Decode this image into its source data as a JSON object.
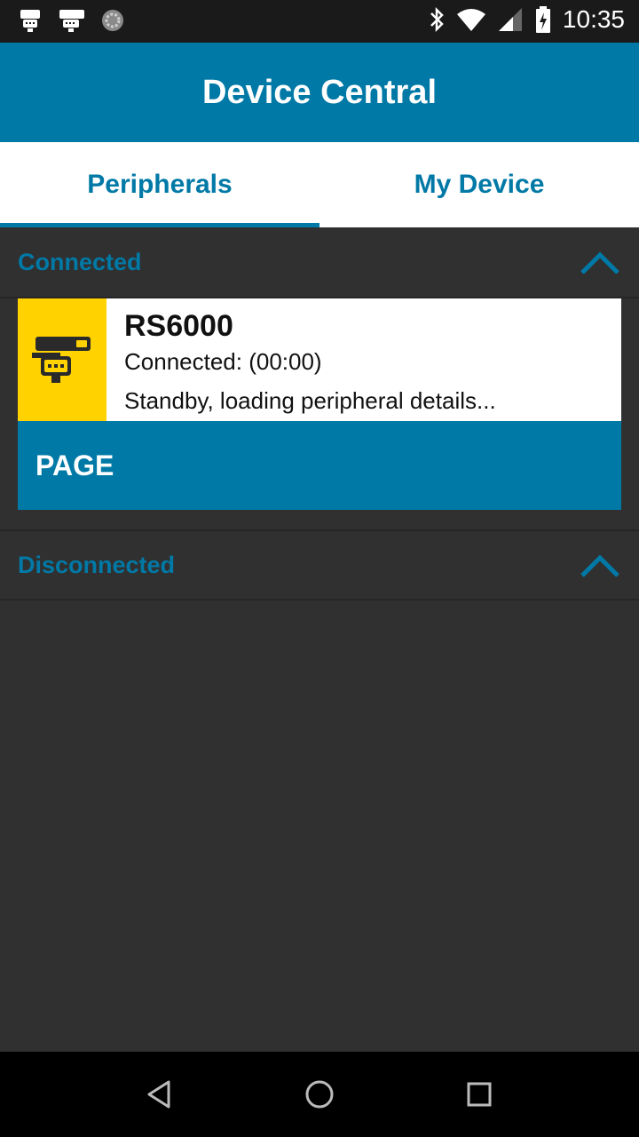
{
  "status_bar": {
    "time": "10:35",
    "left_icons": [
      "scanner-notification-icon",
      "scanner-notification-icon",
      "sync-icon"
    ],
    "right_icons": [
      "bluetooth-icon",
      "wifi-icon",
      "signal-icon",
      "battery-charging-icon"
    ]
  },
  "app_bar": {
    "title": "Device Central"
  },
  "tabs": [
    {
      "label": "Peripherals",
      "active": true
    },
    {
      "label": "My Device",
      "active": false
    }
  ],
  "sections": {
    "connected": {
      "label": "Connected"
    },
    "disconnected": {
      "label": "Disconnected"
    }
  },
  "device_card": {
    "name": "RS6000",
    "status": "Connected: (00:00)",
    "detail": "Standby, loading peripheral details...",
    "icon": "ring-scanner-icon",
    "icon_bg": "#ffd200",
    "action_label": "PAGE"
  },
  "colors": {
    "accent": "#0079a6",
    "background": "#303030"
  },
  "nav_bar": [
    "back-icon",
    "home-icon",
    "recents-icon"
  ]
}
